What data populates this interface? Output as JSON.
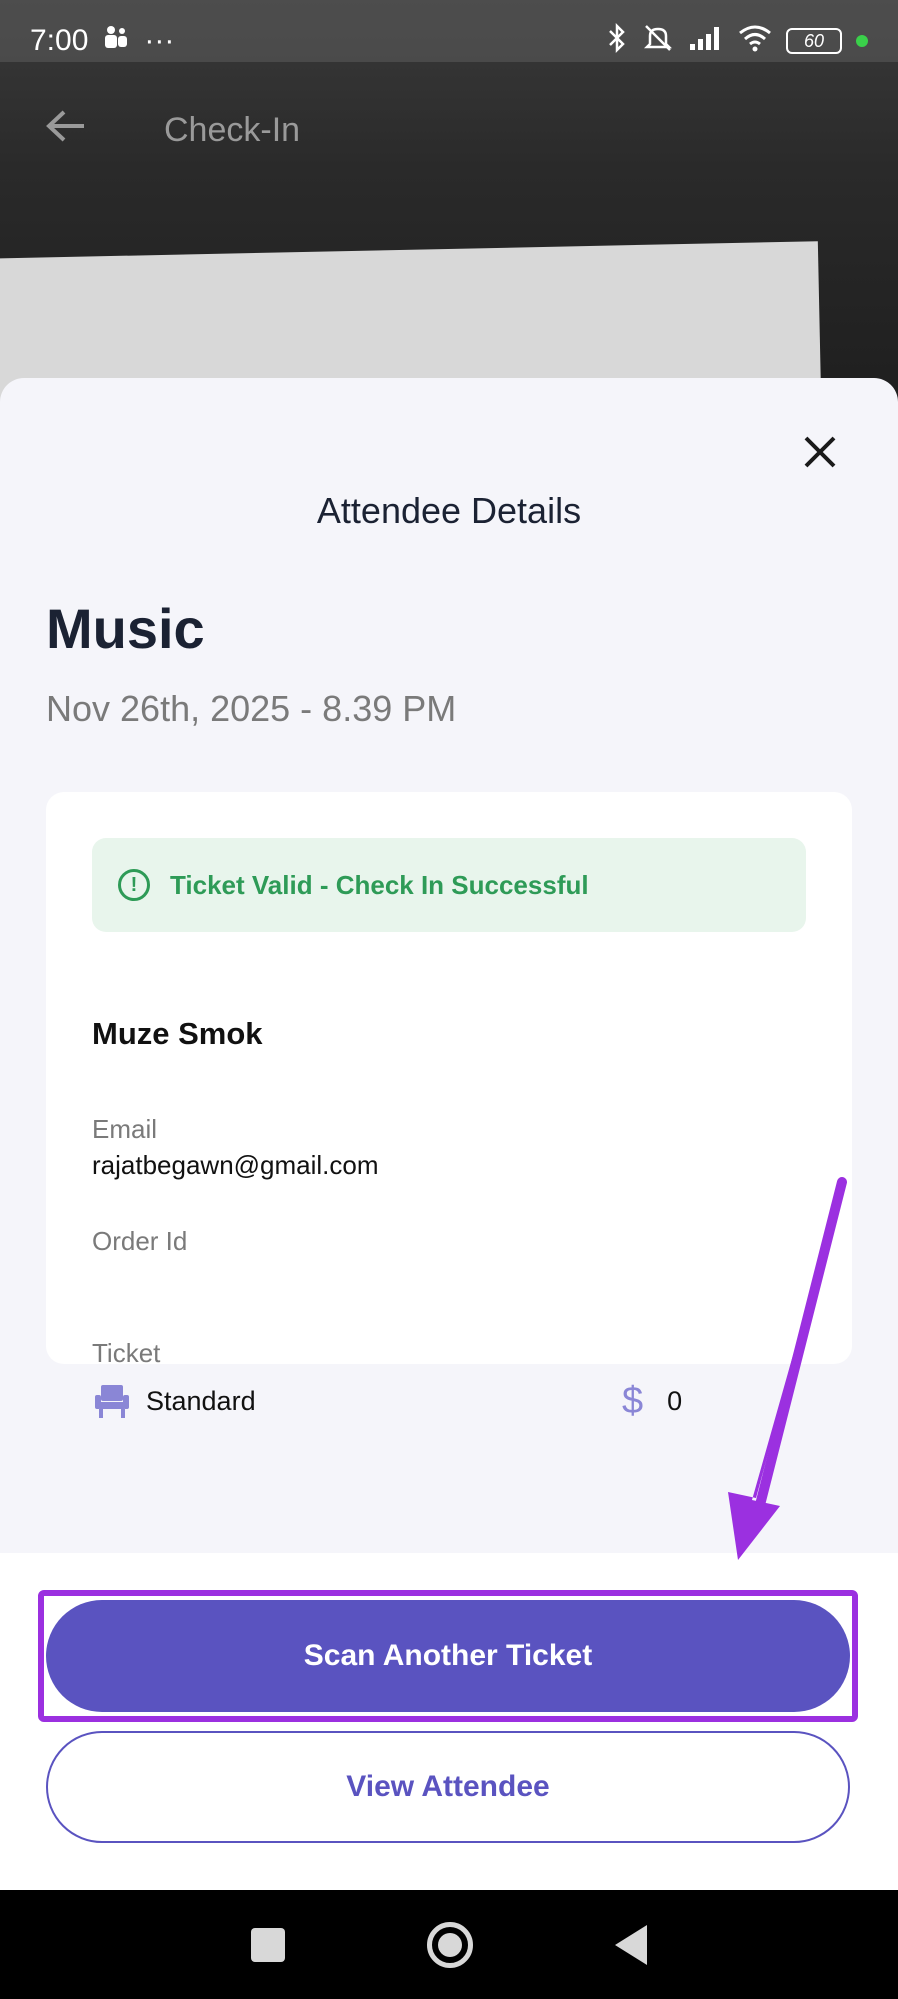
{
  "status_bar": {
    "time": "7:00",
    "dots": "···",
    "battery": "60"
  },
  "app_bar": {
    "title": "Check-In"
  },
  "sheet": {
    "title": "Attendee Details",
    "event_name": "Music",
    "event_date": "Nov 26th, 2025 - 8.39 PM",
    "alert": {
      "text": "Ticket Valid - Check In Successful",
      "color": "#2e9b57"
    },
    "attendee": {
      "name": "Muze Smok",
      "email_label": "Email",
      "email": "rajatbegawn@gmail.com",
      "order_label": "Order Id",
      "order_id": "",
      "ticket_label": "Ticket",
      "ticket_type": "Standard",
      "price": "0"
    }
  },
  "buttons": {
    "primary": "Scan Another Ticket",
    "secondary": "View Attendee"
  },
  "colors": {
    "accent": "#5a53c0",
    "highlight": "#9b30e0",
    "success_bg": "#e8f5ec"
  }
}
